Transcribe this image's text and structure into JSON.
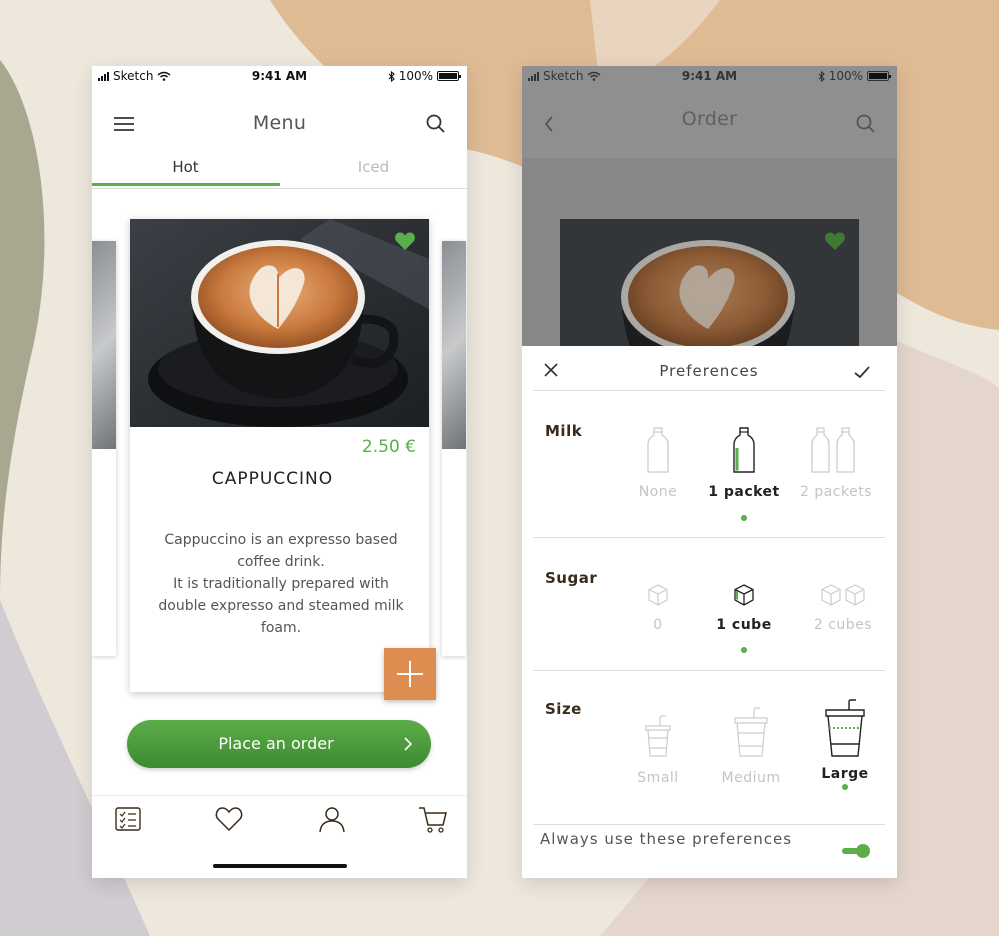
{
  "menu_screen": {
    "status": {
      "carrier": "Sketch",
      "time": "9:41 AM",
      "battery": "100%"
    },
    "title": "Menu",
    "tabs": [
      {
        "label": "Hot",
        "active": true
      },
      {
        "label": "Iced",
        "active": false
      }
    ],
    "product": {
      "price": "2.50 €",
      "name": "CAPPUCCINO",
      "description": "Cappuccino is an expresso based coffee drink.\nIt is traditionally prepared with double expresso and steamed milk foam.",
      "favorite": true
    },
    "order_button": "Place an order",
    "tabbar": [
      "menu-list-icon",
      "heart-icon",
      "user-icon",
      "cart-icon"
    ]
  },
  "order_screen": {
    "status": {
      "carrier": "Sketch",
      "time": "9:41 AM",
      "battery": "100%"
    },
    "title": "Order",
    "sheet": {
      "title": "Preferences",
      "milk": {
        "label": "Milk",
        "options": [
          "None",
          "1 packet",
          "2 packets"
        ],
        "selected": 1
      },
      "sugar": {
        "label": "Sugar",
        "options": [
          "0",
          "1 cube",
          "2 cubes"
        ],
        "selected": 1
      },
      "size": {
        "label": "Size",
        "options": [
          "Small",
          "Medium",
          "Large"
        ],
        "selected": 2
      },
      "always_label": "Always use these preferences",
      "always_enabled": true
    }
  },
  "colors": {
    "accent": "#5aaf4a",
    "add_button": "#dd8d4f",
    "order_button": "#4a9a3b"
  }
}
